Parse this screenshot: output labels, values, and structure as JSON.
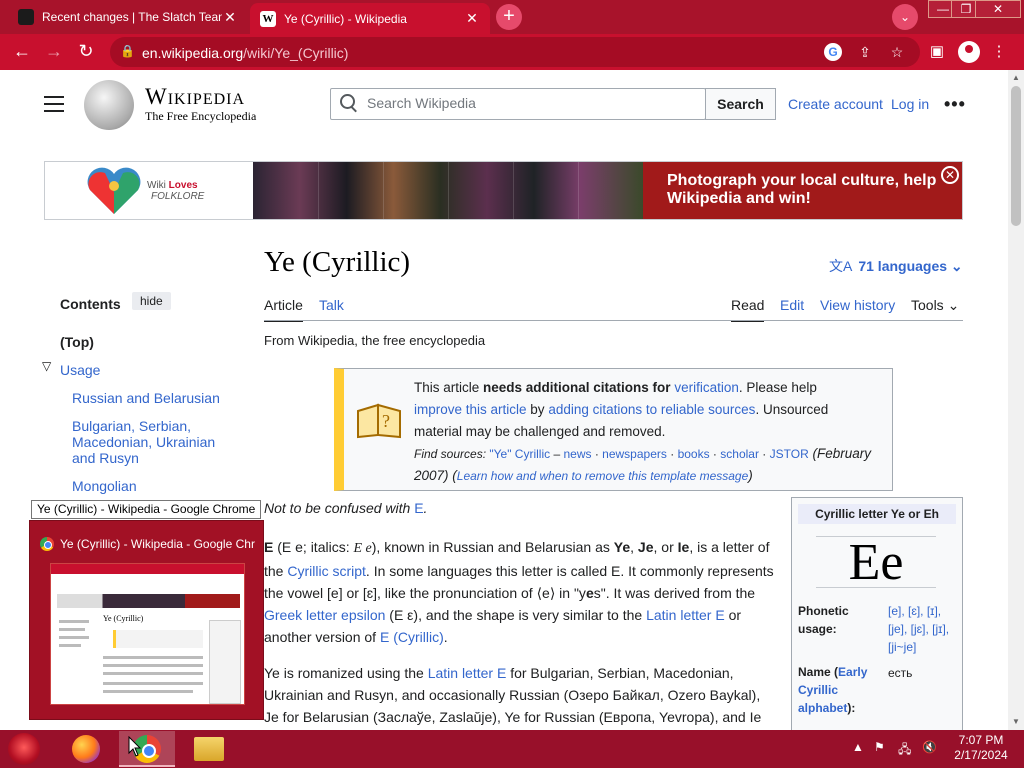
{
  "browser": {
    "tabs": [
      {
        "title": "Recent changes | The Slatch Team",
        "active": false,
        "favicon": "slatch-icon"
      },
      {
        "title": "Ye (Cyrillic) - Wikipedia",
        "active": true,
        "favicon": "wikipedia-w-icon"
      }
    ],
    "new_tab_symbol": "+",
    "url_host": "en.wikipedia.org",
    "url_path": "/wiki/Ye_(Cyrillic)",
    "accent_color": "#c8102e"
  },
  "wiki": {
    "wordmark": "Wikipedia",
    "tagline": "The Free Encyclopedia",
    "search_placeholder": "Search Wikipedia",
    "search_button": "Search",
    "create_account": "Create account",
    "log_in": "Log in",
    "more": "•••"
  },
  "banner": {
    "brand_prefix": "Wiki ",
    "brand_loves": "Loves",
    "brand_sub": "FOLKLORE",
    "cta": "Photograph your local culture, help Wikipedia and win!"
  },
  "toc": {
    "heading": "Contents",
    "hide": "hide",
    "top": "(Top)",
    "usage": "Usage",
    "subitems": [
      "Russian and Belarusian",
      "Bulgarian, Serbian, Macedonian, Ukrainian and Rusyn",
      "Mongolian"
    ]
  },
  "article": {
    "title": "Ye (Cyrillic)",
    "languages": "71 languages",
    "tabs": {
      "article": "Article",
      "talk": "Talk",
      "read": "Read",
      "edit": "Edit",
      "history": "View history",
      "tools": "Tools"
    },
    "from": "From Wikipedia, the free encyclopedia",
    "ambox": {
      "l1_a": "This article ",
      "l1_b": "needs additional citations for ",
      "l1_c": "verification",
      "l1_d": ". Please help",
      "l2_a": "improve this article",
      "l2_b": " by ",
      "l2_c": "adding citations to reliable sources",
      "l2_d": ". Unsourced",
      "l3": "material may be challenged and removed.",
      "fs_label": "Find sources: ",
      "fs_q": "\"Ye\" Cyrillic",
      "fs_news": "news",
      "fs_newspapers": "newspapers",
      "fs_books": "books",
      "fs_scholar": "scholar",
      "fs_jstor": "JSTOR",
      "fs_date": " (February",
      "fs_year": "2007) (",
      "fs_learn": "Learn how and when to remove this template message",
      "fs_close": ")"
    },
    "hatnote_text": "Not to be confused with ",
    "hatnote_link": "E",
    "p1": {
      "a": "E",
      "b": " (Е е; italics: ",
      "c": "Е е",
      "d": "), known in Russian and Belarusian as ",
      "e": "Ye",
      "f": ", ",
      "g": "Je",
      "h": ", or ",
      "i": "Ie",
      "j": ", is a letter of",
      "k": "the ",
      "l": "Cyrillic script",
      "m": ". In some languages this letter is called E. It commonly represents",
      "n": "the vowel [e] or [ɛ], like the pronunciation of ⟨e⟩ in \"y",
      "o": "e",
      "p": "s\". It was derived from the",
      "q": "Greek letter epsilon",
      "r": " (Ε ε), and the shape is very similar to the ",
      "s": "Latin letter E",
      "t": " or",
      "u": "another version of ",
      "v": "E (Cyrillic)",
      "w": "."
    },
    "p2": {
      "a": "Ye is romanized using the ",
      "b": "Latin letter E",
      "c": " for Bulgarian, Serbian, Macedonian,",
      "d": "Ukrainian and Rusyn, and occasionally Russian (Озеро Байкал, Ozero Baykal),",
      "e": "Je for Belarusian (Заслаўе, Zaslaŭje), Ye for Russian (Европа, Yevropa), and Ie"
    }
  },
  "infobox": {
    "header": "Cyrillic letter Ye or Eh",
    "glyph": "Ee",
    "phonetic_label_1": "Phonetic",
    "phonetic_label_2": "usage:",
    "phonetic_v1": "[e], [ɛ], [ɪ],",
    "phonetic_v2": "[je], [jɛ], [jɪ],",
    "phonetic_v3": "[ji~je]",
    "name_label_a": "Name (",
    "name_label_b": "Early",
    "name_label_c": "Cyrillic",
    "name_label_d": "alphabet",
    "name_label_e": "):",
    "name_value": "есть"
  },
  "taskbar": {
    "tooltip": "Ye (Cyrillic) - Wikipedia - Google Chrome",
    "preview_title": "Ye (Cyrillic) - Wikipedia - Google Chrome",
    "preview_mini_title": "Ye (Cyrillic)",
    "time": "7:07 PM",
    "date": "2/17/2024"
  }
}
